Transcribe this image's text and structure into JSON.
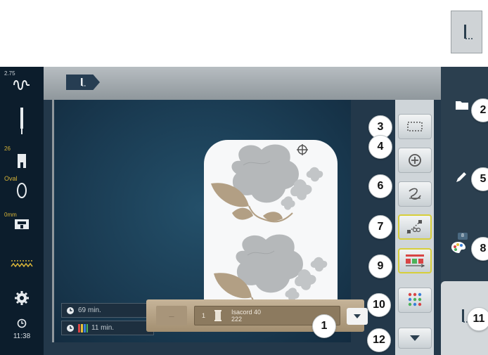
{
  "sidebar": {
    "thread_tension": "2.75",
    "needle_label": "",
    "presser_foot_label": "26",
    "hoop_label": "Oval",
    "feed_dog_label": "0mm",
    "clock": "11:38"
  },
  "design_times": {
    "total_time": "69 min.",
    "color_time": "11 min."
  },
  "thread_bar": {
    "color_number": "1",
    "thread_brand": "Isacord 40",
    "thread_code": "222"
  },
  "right_panel": {
    "color_count_badge": "8"
  },
  "callouts": [
    "1",
    "2",
    "3",
    "4",
    "5",
    "6",
    "7",
    "8",
    "9",
    "10",
    "11",
    "12"
  ],
  "colors": {
    "sidebar_bg": "#0c1d2c",
    "canvas_bg": "#1a3b52",
    "hoop": "#f7f8f9",
    "flower_gray": "#b5b8ba",
    "leaf_tan": "#b29f84",
    "thread_bar": "#b5a284",
    "active_border": "#d7cf3a",
    "label_yellow": "#d6b338"
  },
  "icons": [
    "presser-foot-tab-icon",
    "folder-icon",
    "pencil-icon",
    "color-palette-icon",
    "hoop-outline-icon",
    "crosshair-icon",
    "connect-stitch-icon",
    "thread-cut-icon",
    "color-order-icon",
    "color-grid-icon",
    "scroll-down-icon",
    "clock-icon",
    "color-bars-icon",
    "spool-icon",
    "dropdown-arrow-icon"
  ]
}
